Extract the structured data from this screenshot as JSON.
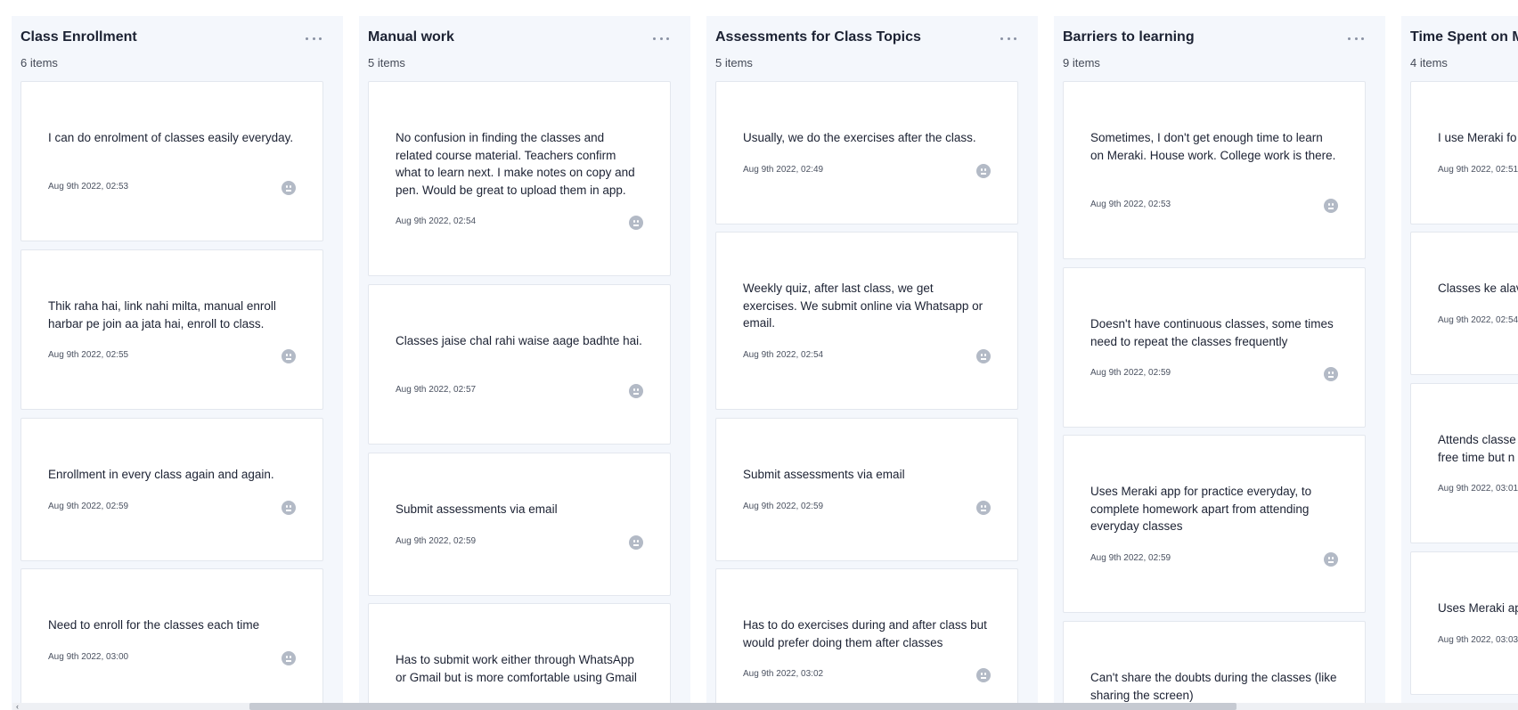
{
  "columns": [
    {
      "title": "Class Enrollment",
      "count": "6 items",
      "cards": [
        {
          "text": "I can do enrolment of classes easily everyday.",
          "time": "Aug 9th 2022, 02:53"
        },
        {
          "text": "Thik raha hai, link nahi milta, manual enroll harbar pe join aa jata hai, enroll to class.",
          "time": "Aug 9th 2022, 02:55"
        },
        {
          "text": "Enrollment in every class again and again.",
          "time": "Aug 9th 2022, 02:59"
        },
        {
          "text": "Need to enroll for the classes each time",
          "time": "Aug 9th 2022, 03:00"
        }
      ]
    },
    {
      "title": "Manual work",
      "count": "5 items",
      "cards": [
        {
          "text": "No confusion in finding the classes and related course material. Teachers confirm what to learn next. I make notes on copy and pen. Would be great to upload them in app.",
          "time": "Aug 9th 2022, 02:54"
        },
        {
          "text": "Classes jaise chal rahi waise aage badhte hai.",
          "time": "Aug 9th 2022, 02:57"
        },
        {
          "text": "Submit assessments via email",
          "time": "Aug 9th 2022, 02:59"
        },
        {
          "text": "Has to submit work either through WhatsApp or Gmail but is more comfortable using Gmail",
          "time": ""
        }
      ]
    },
    {
      "title": "Assessments for Class Topics",
      "count": "5 items",
      "cards": [
        {
          "text": "Usually, we do the exercises after the class.",
          "time": "Aug 9th 2022, 02:49"
        },
        {
          "text": "Weekly quiz, after last class, we get exercises. We submit online via Whatsapp or email.",
          "time": "Aug 9th 2022, 02:54"
        },
        {
          "text": "Submit assessments via email",
          "time": "Aug 9th 2022, 02:59"
        },
        {
          "text": "Has to do exercises during and after class but would prefer doing them after classes",
          "time": "Aug 9th 2022, 03:02"
        }
      ]
    },
    {
      "title": "Barriers to learning",
      "count": "9 items",
      "cards": [
        {
          "text": "Sometimes, I don't get enough time to learn on Meraki. House work. College work is there.",
          "time": "Aug 9th 2022, 02:53"
        },
        {
          "text": "Doesn't have continuous classes, some times need to repeat the classes frequently",
          "time": "Aug 9th 2022, 02:59"
        },
        {
          "text": "Uses Meraki app for practice everyday, to complete homework apart from attending everyday classes",
          "time": "Aug 9th 2022, 02:59"
        },
        {
          "text": "Can't share the doubts during the classes (like sharing the screen)",
          "time": ""
        }
      ]
    },
    {
      "title": "Time Spent on M",
      "count": "4 items",
      "cards": [
        {
          "text": "I use Meraki fo",
          "time": "Aug 9th 2022, 02:51"
        },
        {
          "text": "Classes ke alav",
          "time": "Aug 9th 2022, 02:54"
        },
        {
          "text": "Attends classe\nfree time but n",
          "time": "Aug 9th 2022, 03:01"
        },
        {
          "text": "Uses Meraki ap",
          "time": "Aug 9th 2022, 03:03"
        }
      ]
    }
  ],
  "icons": {
    "column_menu": "more-horizontal-icon",
    "reaction": "neutral-face-icon",
    "scroll_left": "chevron-left-icon"
  },
  "colors": {
    "column_bg": "#f4f7fc",
    "card_bg": "#ffffff",
    "icon": "#b3bac6"
  }
}
